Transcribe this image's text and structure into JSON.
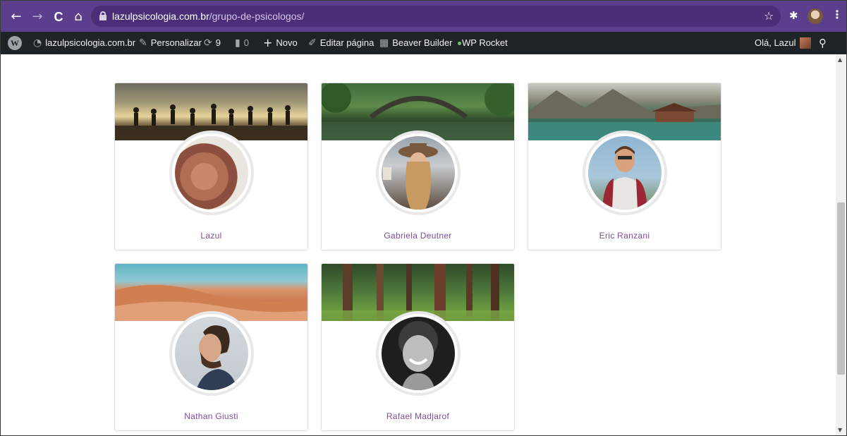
{
  "browser": {
    "url_domain": "lazulpsicologia.com.br",
    "url_path": "/grupo-de-psicologos/",
    "back": "←",
    "forward": "→",
    "reload": "C",
    "home": "⌂",
    "star": "☆",
    "extension": "✱",
    "menu": "⋮"
  },
  "wpbar": {
    "site": "lazulpsicologia.com.br",
    "customize": "Personalizar",
    "updates_count": "9",
    "comments_count": "0",
    "new": "Novo",
    "edit_page": "Editar página",
    "beaver": "Beaver Builder",
    "rocket": "WP Rocket",
    "greeting": "Olá, Lazul"
  },
  "psychologists": [
    {
      "name": "Lazul"
    },
    {
      "name": "Gabriela Deutner"
    },
    {
      "name": "Eric Ranzani"
    },
    {
      "name": "Nathan Giusti"
    },
    {
      "name": "Rafael Madjarof"
    }
  ],
  "colors": {
    "browser_bar": "#5b3e8c",
    "admin_bar": "#1d2327",
    "name_text": "#7c4e9a"
  }
}
